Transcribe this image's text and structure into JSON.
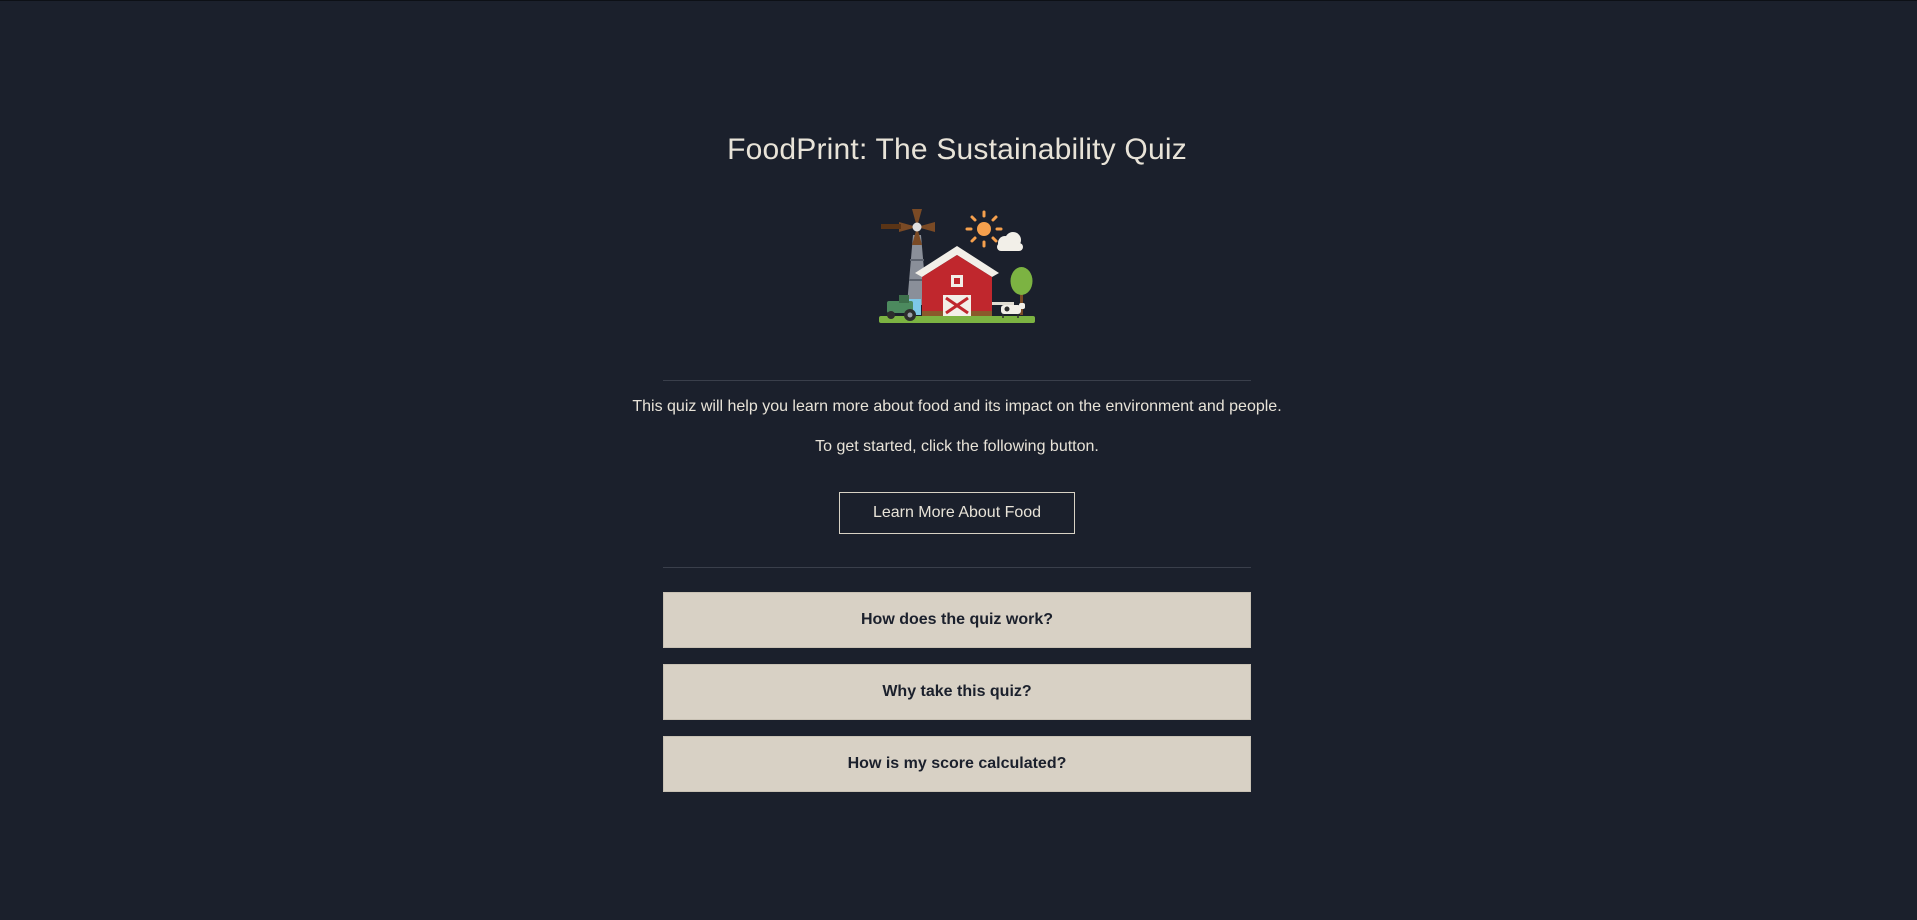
{
  "page": {
    "title": "FoodPrint: The Sustainability Quiz",
    "intro_text": "This quiz will help you learn more about food and its impact on the environment and people.",
    "instruction_text": "To get started, click the following button.",
    "learn_button_label": "Learn More About Food",
    "hero_icon": "farm-illustration"
  },
  "faq": [
    {
      "label": "How does the quiz work?"
    },
    {
      "label": "Why take this quiz?"
    },
    {
      "label": "How is my score calculated?"
    }
  ],
  "colors": {
    "background": "#1b202c",
    "text": "#e8e3d8",
    "faq_background": "#d8d1c5",
    "faq_text": "#1b202c",
    "barn_red": "#c0272d",
    "grass": "#7cb342",
    "sun": "#f6a04d"
  }
}
